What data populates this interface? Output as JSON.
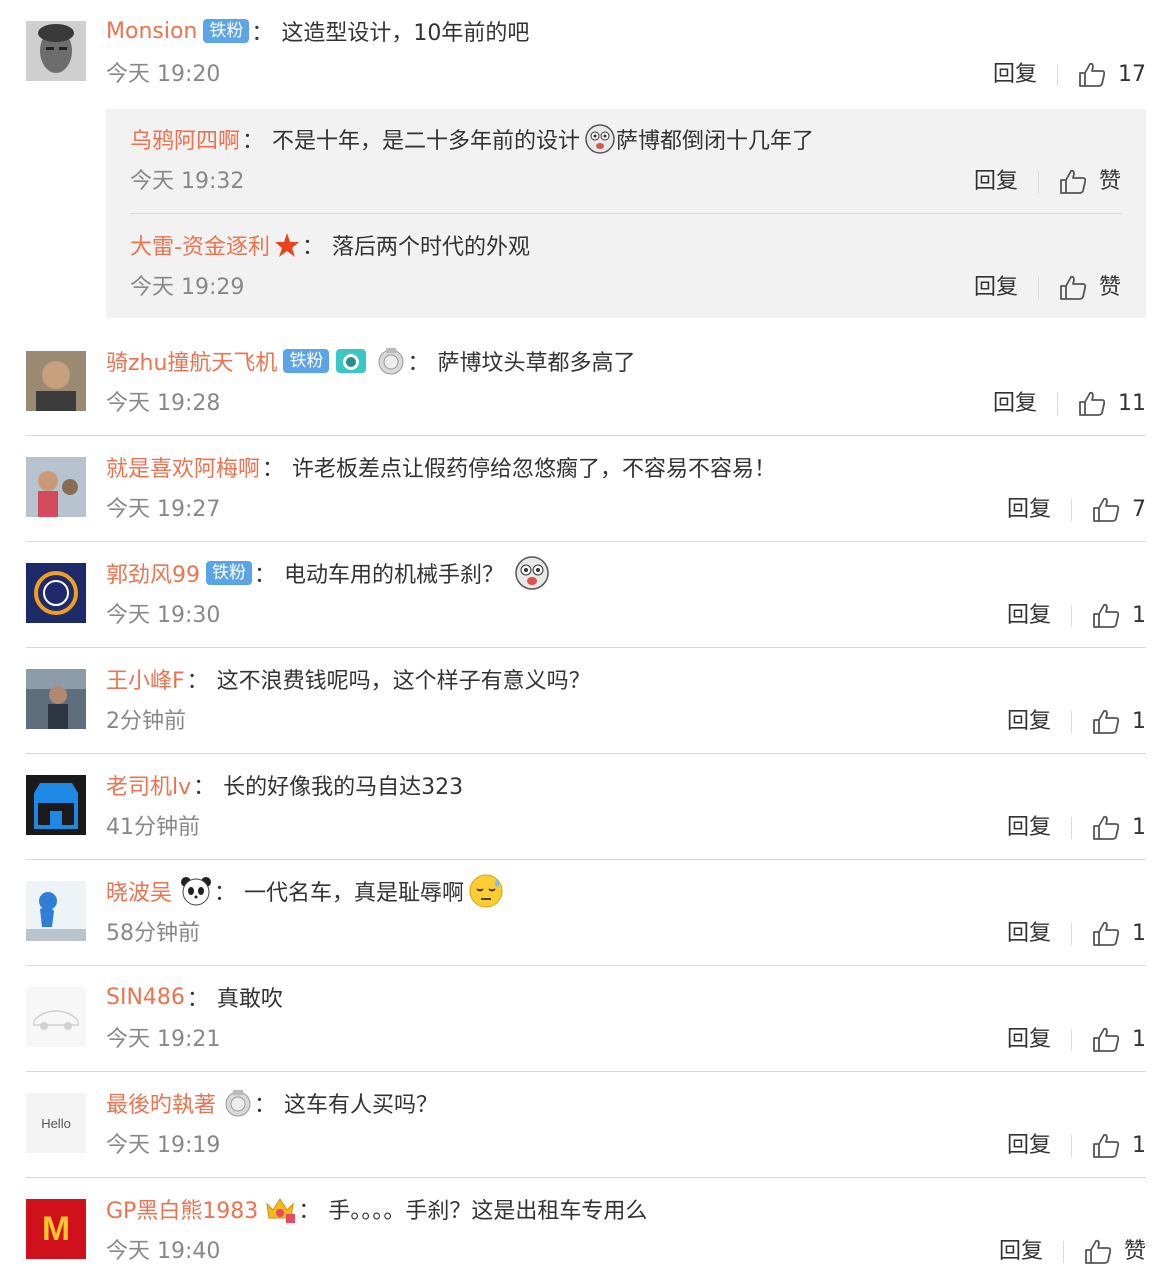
{
  "labels": {
    "reply": "回复",
    "badge_tiefen": "铁粉"
  },
  "comments": [
    {
      "user": "Monsion",
      "text": "这造型设计，10年前的吧",
      "time": "今天 19:20",
      "likes": "17"
    },
    {
      "user": "骑zhu撞航天飞机",
      "text": "萨博坟头草都多高了",
      "time": "今天 19:28",
      "likes": "11"
    },
    {
      "user": "就是喜欢阿梅啊",
      "text": "许老板差点让假药停给忽悠瘸了，不容易不容易！",
      "time": "今天 19:27",
      "likes": "7"
    },
    {
      "user": "郭劲风99",
      "text": "电动车用的机械手刹？",
      "time": "今天 19:30",
      "likes": "1"
    },
    {
      "user": "王小峰F",
      "text": "这不浪费钱呢吗，这个样子有意义吗？",
      "time": "2分钟前",
      "likes": "1"
    },
    {
      "user": "老司机lv",
      "text": "长的好像我的马自达323",
      "time": "41分钟前",
      "likes": "1"
    },
    {
      "user": "晓波吴",
      "text": "一代名车，真是耻辱啊",
      "time": "58分钟前",
      "likes": "1"
    },
    {
      "user": "SIN486",
      "text": "真敢吹",
      "time": "今天 19:21",
      "likes": "1"
    },
    {
      "user": "最後旳執著",
      "text": "这车有人买吗？",
      "time": "今天 19:19",
      "likes": "1"
    },
    {
      "user": "GP黑白熊1983",
      "text": "手。。。。手刹？这是出租车专用么",
      "time": "今天 19:40",
      "likes": "赞"
    }
  ],
  "replies": [
    {
      "user": "乌鸦阿四啊",
      "text_a": "不是十年，是二十多年前的设计",
      "text_b": "萨博都倒闭十几年了",
      "time": "今天 19:32",
      "likes": "赞"
    },
    {
      "user": "大雷-资金逐利",
      "text": "落后两个时代的外观",
      "time": "今天 19:29",
      "likes": "赞"
    }
  ],
  "avatars": {
    "c8_text": "Hello",
    "c9_text": "M"
  },
  "colors": {
    "username": "#eb7350",
    "badge": "#5ba4e8",
    "time": "#888888",
    "nested_bg": "#f2f2f2"
  }
}
